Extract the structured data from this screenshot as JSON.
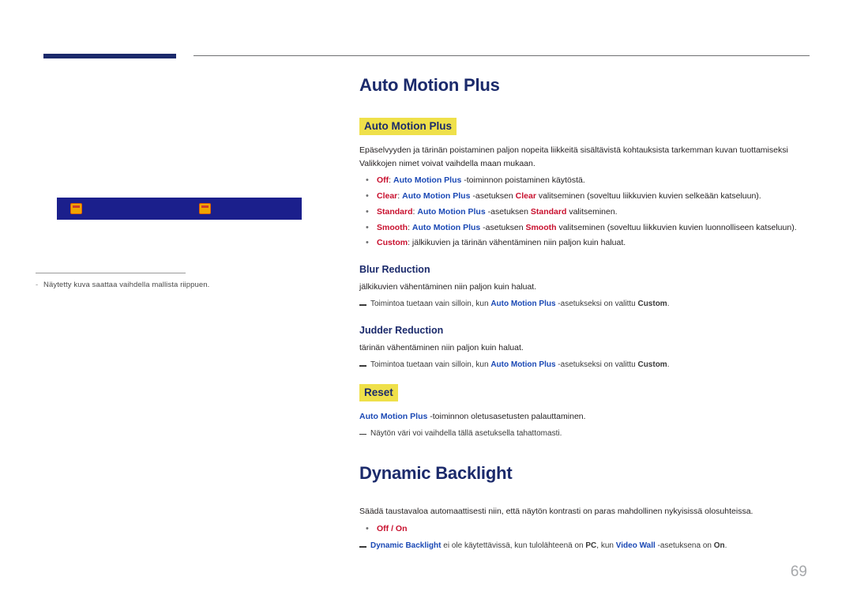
{
  "page": {
    "number": "69"
  },
  "left": {
    "menu_preview": {
      "icon_left": "picture-icon",
      "icon_right": "picture-icon"
    },
    "footnote": "Näytetty kuva saattaa vaihdella mallista riippuen."
  },
  "sections": [
    {
      "id": "auto-motion-plus",
      "title": "Auto Motion Plus",
      "highlight_label": "Auto Motion Plus",
      "intro_line1": "Epäselvyyden ja tärinän poistaminen paljon nopeita liikkeitä sisältävistä kohtauksista tarkemman kuvan tuottamiseksi",
      "intro_line2": "Valikkojen nimet voivat vaihdella maan mukaan.",
      "bullets": [
        {
          "lead": "Off",
          "lead_color": "red",
          "term": "Auto Motion Plus",
          "rest": " -toiminnon poistaminen käytöstä."
        },
        {
          "lead": "Clear",
          "lead_color": "red",
          "term": "Auto Motion Plus",
          "rest": " -asetuksen ",
          "emph": "Clear",
          "tail": " valitseminen (soveltuu liikkuvien kuvien selkeään katseluun)."
        },
        {
          "lead": "Standard",
          "lead_color": "red",
          "term": "Auto Motion Plus",
          "rest": " -asetuksen ",
          "emph": "Standard",
          "tail": " valitseminen."
        },
        {
          "lead": "Smooth",
          "lead_color": "red",
          "term": "Auto Motion Plus",
          "rest": " -asetuksen ",
          "emph": "Smooth",
          "tail": " valitseminen (soveltuu liikkuvien kuvien luonnolliseen katseluun)."
        },
        {
          "lead": "Custom",
          "lead_color": "red",
          "rest": ": jälkikuvien ja tärinän vähentäminen niin paljon kuin haluat."
        }
      ],
      "sub_blocks": [
        {
          "heading": "Blur Reduction",
          "body": "jälkikuvien vähentäminen niin paljon kuin haluat.",
          "note_prefix": "Toimintoa tuetaan vain silloin, kun ",
          "note_term": "Auto Motion Plus",
          "note_mid": " -asetukseksi on valittu ",
          "note_value": "Custom",
          "note_suffix": "."
        },
        {
          "heading": "Judder Reduction",
          "body": "tärinän vähentäminen niin paljon kuin haluat.",
          "note_prefix": "Toimintoa tuetaan vain silloin, kun ",
          "note_term": "Auto Motion Plus",
          "note_mid": " -asetukseksi on valittu ",
          "note_value": "Custom",
          "note_suffix": "."
        }
      ],
      "reset": {
        "highlight_label": "Reset",
        "body_term": "Auto Motion Plus",
        "body_rest": " -toiminnon oletusasetusten palauttaminen.",
        "note": "Näytön väri voi vaihdella tällä asetuksella tahattomasti."
      }
    },
    {
      "id": "dynamic-backlight",
      "title": "Dynamic Backlight",
      "intro": "Säädä taustavaloa automaattisesti niin, että näytön kontrasti on paras mahdollinen nykyisissä olosuhteissa.",
      "bullet": "Off / On",
      "note_parts": {
        "p1_term": "Dynamic Backlight",
        "p2": " ei ole käytettävissä, kun tulolähteenä on ",
        "p3_value": "PC",
        "p4": ", kun ",
        "p5_term": "Video Wall",
        "p6": " -asetuksena on ",
        "p7_value": "On",
        "p8": "."
      }
    }
  ]
}
